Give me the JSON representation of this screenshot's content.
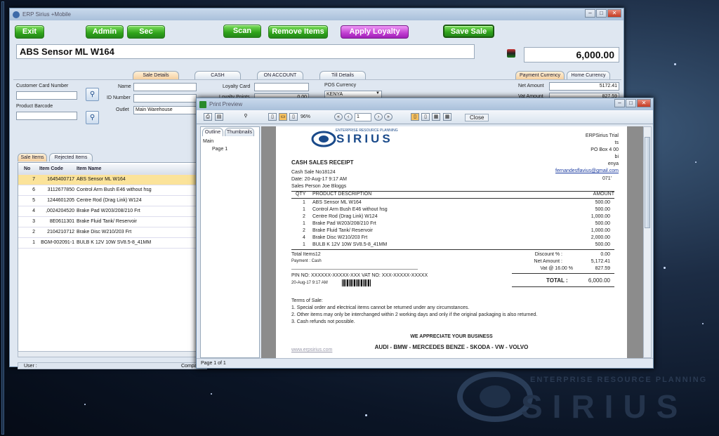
{
  "background": {
    "logo_sub": "ENTERPRISE RESOURCE PLANNING",
    "logo_big": "SIRIUS"
  },
  "main_window": {
    "title": "ERP Sirius +Mobile",
    "buttons": {
      "exit": "Exit",
      "admin": "Admin",
      "sec": "Sec",
      "scan": "Scan",
      "remove_items": "Remove Items",
      "apply_loyalty": "Apply Loyalty",
      "save_sale": "Save Sale"
    },
    "item_title": "ABS Sensor  ML W164",
    "total": "6,000.00",
    "tabs": {
      "sale_details": "Sale Details",
      "cash": "CASH",
      "on_account": "ON ACCOUNT",
      "till_details": "Till Details",
      "payment_currency": "Payment Currency",
      "home_currency": "Home Currency"
    },
    "fields": {
      "customer_card_number": "Customer Card Number",
      "product_barcode": "Product Barcode",
      "name": "Name",
      "id_number": "ID Number",
      "outlet": "Outlet",
      "outlet_value": "Main Warehouse",
      "loyalty_card": "Loyalty Card",
      "loyalty_points": "Loyalty Points",
      "loyalty_points_value": "0.00",
      "pos_currency": "POS Currency",
      "pos_currency_value": "KENYA",
      "net_amount": "Net Amount",
      "net_amount_value": "5172.41",
      "vat_amount": "Vat Amount",
      "vat_amount_value": "827.59"
    },
    "grid_tabs": {
      "sale_items": "Sale Items",
      "rejected_items": "Rejected Items"
    },
    "grid": {
      "headers": {
        "no": "No",
        "item_code": "Item Code",
        "item_name": "Item Name"
      },
      "rows": [
        {
          "no": "7",
          "code": "1645400717",
          "name": "ABS Sensor  ML W164"
        },
        {
          "no": "6",
          "code": "3112677850",
          "name": "Control Arm Bush E46 without hsg"
        },
        {
          "no": "5",
          "code": "1244601205",
          "name": "Centre Rod (Drag Link) W124"
        },
        {
          "no": "4",
          "code": ",0024204520",
          "name": "Brake Pad W203/208/210 Frt"
        },
        {
          "no": "3",
          "code": "8E0611301",
          "name": "Brake Fluid Tank/ Reservoir"
        },
        {
          "no": "2",
          "code": "2104210712",
          "name": "Brake Disc W210/203 Frt"
        },
        {
          "no": "1",
          "code": "BGM-002091-1",
          "name": "BULB K 12V 10W SV8.5-8_41MM"
        }
      ]
    },
    "status": {
      "user": "User :",
      "company": "Compa"
    }
  },
  "print_preview": {
    "title": "Print Preview",
    "zoom": "96%",
    "page_input": "1",
    "close": "Close",
    "outline_tab": "Outline",
    "thumbnails_tab": "Thumbnails",
    "tree_root": "Main",
    "tree_child": "Page 1",
    "status": "Page 1 of 1",
    "receipt": {
      "logo_sub": "ENTERPRISE RESOURCE PLANNING",
      "logo": "SIRIUS",
      "company": "ERPSirius Trial",
      "company_line2": "ts",
      "po_box": "PO Box 4        00",
      "company_line4": "bi",
      "country": "enya",
      "email": "fernandesflavius@gmail.com",
      "phone": "071'",
      "heading": "CASH SALES RECEIPT",
      "sale_no": "Cash Sale No18124",
      "date": "Date: 20-Aug-17 9:17 AM",
      "sales_person": "Sales Person Joe Bloggs",
      "col_qty": "QTY",
      "col_desc": "PRODUCT DESCRIPTION",
      "col_amount": "AMOUNT",
      "lines": [
        {
          "qty": "1",
          "desc": "ABS Sensor  ML W164",
          "amount": "500.00"
        },
        {
          "qty": "1",
          "desc": "Control Arm Bush E46 without hsg",
          "amount": "500.00"
        },
        {
          "qty": "2",
          "desc": "Centre Rod (Drag Link) W124",
          "amount": "1,000.00"
        },
        {
          "qty": "1",
          "desc": "Brake Pad W203/208/210 Frt",
          "amount": "500.00"
        },
        {
          "qty": "2",
          "desc": "Brake Fluid Tank/ Reservoir",
          "amount": "1,000.00"
        },
        {
          "qty": "4",
          "desc": "Brake Disc W210/203 Frt",
          "amount": "2,000.00"
        },
        {
          "qty": "1",
          "desc": "BULB K 12V 10W SV8.5-8_41MM",
          "amount": "500.00"
        }
      ],
      "total_items": "Total Items12",
      "payment": "Payment : Cash",
      "discount_label": "Discount % :",
      "discount_value": "0.00",
      "net_label": "Net Amount :",
      "net_value": "5,172.41",
      "vat_label": "Vat @   16.00 %",
      "vat_value": "827.59",
      "total_label": "TOTAL :",
      "total_value": "6,000.00",
      "pin": "PIN NO: XXXXXX-XXXXX-XXX  VAT NO: XXX-XXXXX-XXXXX",
      "stamp": "20-Aug-17 9:17 AM",
      "terms_title": "Terms of Sale:",
      "terms": [
        "1. Special order and electrical items cannot be returned under any circumstances.",
        "2. Other items may only be interchanged within 2 working days and only if the original packaging is also returned.",
        "3. Cash refunds not possible."
      ],
      "appreciation": "WE APPRECIATE YOUR BUSINESS",
      "brands": "AUDI  - BMW  -  MERCEDES BENZE  -  SKODA  -  VW  -  VOLVO",
      "website": "www.erpsirius.com"
    }
  },
  "colors": {
    "green_button": "#2fa31a",
    "purple_button": "#c03fd0",
    "highlight_row": "#fbe39a",
    "link": "#1a3aa0"
  }
}
